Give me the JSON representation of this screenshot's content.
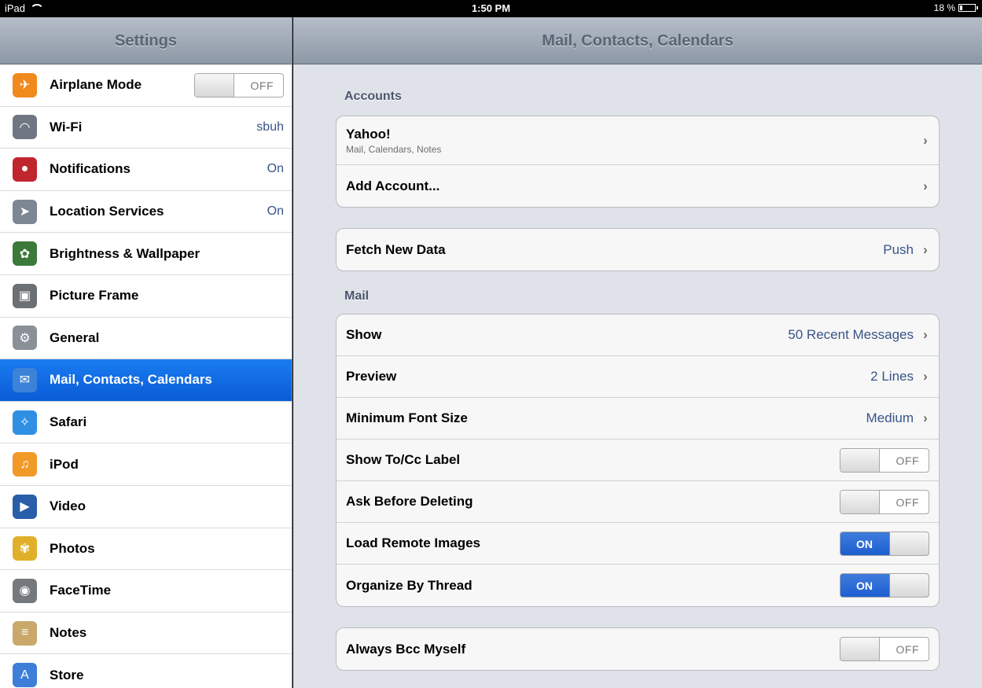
{
  "status_bar": {
    "device": "iPad",
    "time": "1:50 PM",
    "battery": "18 %"
  },
  "sidebar": {
    "title": "Settings",
    "items": [
      {
        "label": "Airplane Mode",
        "icon": "airplane-icon",
        "toggle": "OFF"
      },
      {
        "label": "Wi-Fi",
        "icon": "wifi-icon",
        "value": "sbuh"
      },
      {
        "label": "Notifications",
        "icon": "notifications-icon",
        "value": "On"
      },
      {
        "label": "Location Services",
        "icon": "location-icon",
        "value": "On"
      },
      {
        "label": "Brightness & Wallpaper",
        "icon": "brightness-icon"
      },
      {
        "label": "Picture Frame",
        "icon": "picture-frame-icon"
      },
      {
        "label": "General",
        "icon": "gear-icon"
      },
      {
        "label": "Mail, Contacts, Calendars",
        "icon": "mail-icon",
        "selected": true
      },
      {
        "label": "Safari",
        "icon": "safari-icon"
      },
      {
        "label": "iPod",
        "icon": "ipod-icon"
      },
      {
        "label": "Video",
        "icon": "video-icon"
      },
      {
        "label": "Photos",
        "icon": "photos-icon"
      },
      {
        "label": "FaceTime",
        "icon": "facetime-icon"
      },
      {
        "label": "Notes",
        "icon": "notes-icon"
      },
      {
        "label": "Store",
        "icon": "store-icon"
      }
    ]
  },
  "detail": {
    "title": "Mail, Contacts, Calendars",
    "accounts_title": "Accounts",
    "accounts": [
      {
        "label": "Yahoo!",
        "sub": "Mail, Calendars, Notes"
      },
      {
        "label": "Add Account..."
      }
    ],
    "fetch": {
      "label": "Fetch New Data",
      "value": "Push"
    },
    "mail_title": "Mail",
    "mail_rows": [
      {
        "label": "Show",
        "value": "50 Recent Messages"
      },
      {
        "label": "Preview",
        "value": "2 Lines"
      },
      {
        "label": "Minimum Font Size",
        "value": "Medium"
      },
      {
        "label": "Show To/Cc Label",
        "toggle": "OFF"
      },
      {
        "label": "Ask Before Deleting",
        "toggle": "OFF"
      },
      {
        "label": "Load Remote Images",
        "toggle": "ON"
      },
      {
        "label": "Organize By Thread",
        "toggle": "ON"
      }
    ],
    "more_rows": [
      {
        "label": "Always Bcc Myself",
        "toggle": "OFF"
      }
    ]
  },
  "colors": {
    "selected": "#0a5cd6",
    "value_text": "#385487",
    "toggle_on": "#1d5fd0"
  }
}
